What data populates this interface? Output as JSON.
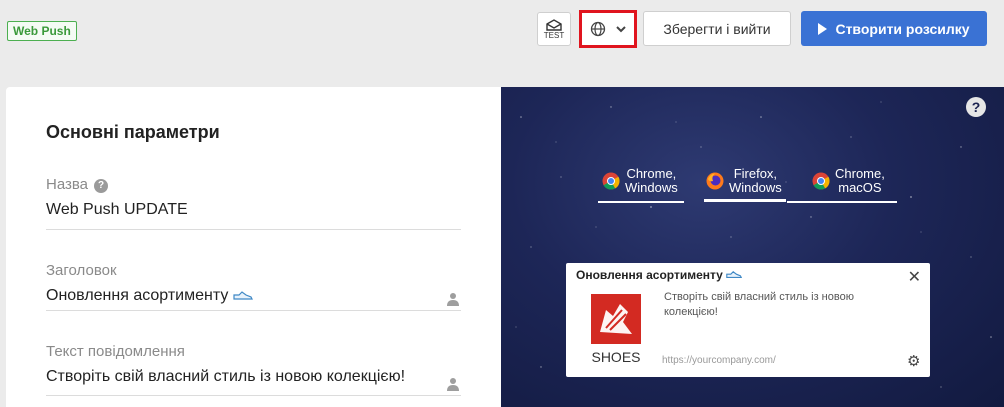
{
  "topbar": {
    "badge": "Web Push",
    "test_label": "TEST",
    "save_label": "Зберегти і вийти",
    "create_label": "Створити розсилку"
  },
  "form": {
    "section_title": "Основні параметри",
    "name_label": "Назва",
    "name_value": "Web Push UPDATE",
    "title_label": "Заголовок",
    "title_value": "Оновлення асортименту",
    "message_label": "Текст повідомлення",
    "message_value": "Створіть свій власний стиль із новою колекцією!"
  },
  "preview": {
    "tabs": [
      {
        "line1": "Chrome,",
        "line2": "Windows",
        "browser": "chrome",
        "active": false
      },
      {
        "line1": "Firefox,",
        "line2": "Windows",
        "browser": "firefox",
        "active": true
      },
      {
        "line1": "Chrome,",
        "line2": "macOS",
        "browser": "chrome",
        "active": false
      }
    ],
    "notification": {
      "title": "Оновлення асортименту",
      "body": "Створіть свій власний стиль із новою колекцією!",
      "url": "https://yourcompany.com/",
      "image_text": "SHOES"
    }
  },
  "colors": {
    "accent": "#3a72d4",
    "highlight": "#e0141e",
    "badge": "#4caf50"
  },
  "icons": [
    "test-envelope-icon",
    "globe-icon",
    "chevron-down-icon",
    "play-icon",
    "help-icon",
    "person-icon",
    "sneaker-icon",
    "chrome-icon",
    "firefox-icon",
    "close-icon",
    "gear-icon"
  ]
}
